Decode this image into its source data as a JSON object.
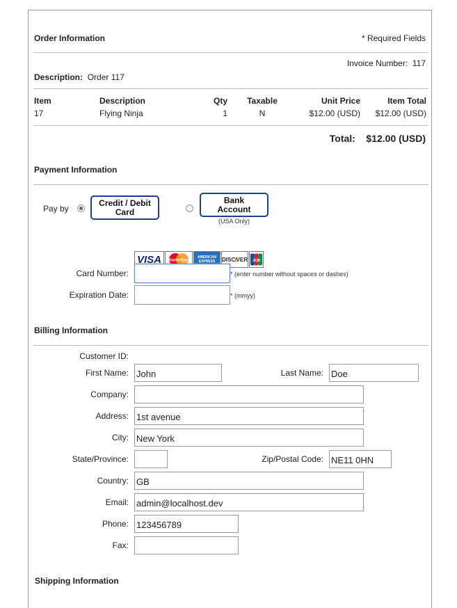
{
  "order": {
    "heading": "Order Information",
    "required_note": "* Required Fields",
    "invoice_label": "Invoice Number:",
    "invoice_value": "117",
    "description_label": "Description:",
    "description_value": "Order 117",
    "columns": [
      "Item",
      "Description",
      "Qty",
      "Taxable",
      "Unit Price",
      "Item Total"
    ],
    "rows": [
      {
        "item": "17",
        "description": "Flying Ninja",
        "qty": "1",
        "taxable": "N",
        "unit_price": "$12.00 (USD)",
        "item_total": "$12.00 (USD)"
      }
    ],
    "total_label": "Total:",
    "total_value": "$12.00 (USD)"
  },
  "payment": {
    "heading": "Payment Information",
    "pay_by_label": "Pay by",
    "credit_label_1": "Credit / Debit",
    "credit_label_2": "Card",
    "bank_label_1": "Bank",
    "bank_label_2": "Account",
    "bank_note": "(USA Only)",
    "selected": "credit",
    "card_logos": [
      "VISA",
      "MasterCard",
      "American Express",
      "DISCOVER",
      "JCB"
    ],
    "card_number_label": "Card Number:",
    "card_number_value": "",
    "card_number_hint": "* (enter number without spaces or dashes)",
    "expiration_label": "Expiration Date:",
    "expiration_value": "",
    "expiration_hint": "* (mmyy)"
  },
  "billing": {
    "heading": "Billing Information",
    "customer_id_label": "Customer ID:",
    "first_name_label": "First Name:",
    "first_name": "John",
    "last_name_label": "Last Name:",
    "last_name": "Doe",
    "company_label": "Company:",
    "company": "",
    "address_label": "Address:",
    "address": "1st avenue",
    "city_label": "City:",
    "city": "New York",
    "state_label": "State/Province:",
    "state": "",
    "zip_label": "Zip/Postal Code:",
    "zip": "NE11 0HN",
    "country_label": "Country:",
    "country": "GB",
    "email_label": "Email:",
    "email": "admin@localhost.dev",
    "phone_label": "Phone:",
    "phone": "123456789",
    "fax_label": "Fax:",
    "fax": ""
  },
  "shipping": {
    "heading": "Shipping Information"
  },
  "colors": {
    "button_border": "#1d3f95",
    "focus_border": "#4d8fe0",
    "visa_blue": "#1a1f71",
    "mastercard_red": "#eb001b",
    "mastercard_orange": "#f79e1b",
    "amex_blue": "#2671b9",
    "discover_orange": "#f58220"
  }
}
